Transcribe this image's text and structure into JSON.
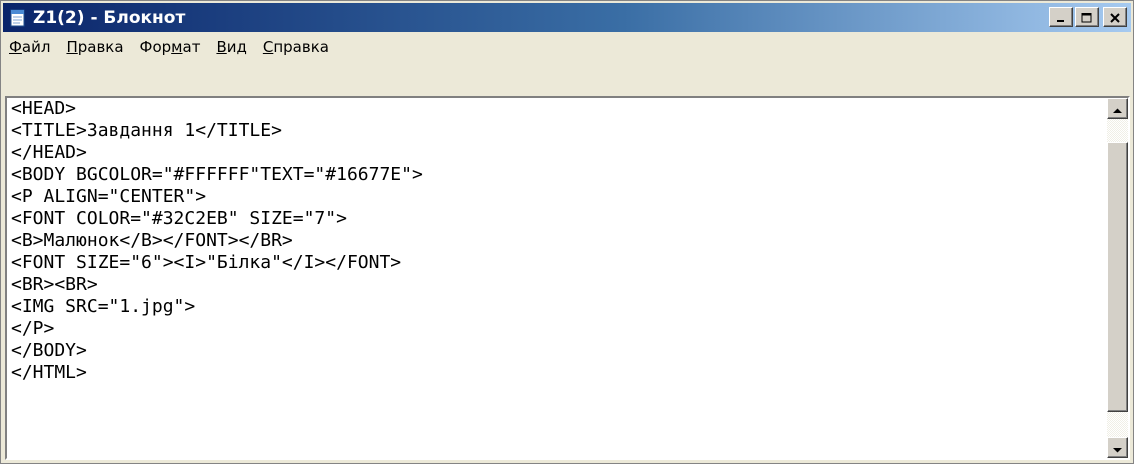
{
  "window": {
    "title": "Z1(2) - Блокнот",
    "icon": "notepad-icon",
    "controls": [
      "minimize-icon",
      "maximize-icon",
      "close-icon"
    ]
  },
  "menubar": {
    "items": [
      {
        "label": "Файл",
        "underline_index": 0
      },
      {
        "label": "Правка",
        "underline_index": 0
      },
      {
        "label": "Формат",
        "underline_index": 3
      },
      {
        "label": "Вид",
        "underline_index": 0
      },
      {
        "label": "Справка",
        "underline_index": 0
      }
    ]
  },
  "editor": {
    "lines": [
      "<HEAD>",
      "<TITLE>Завдання 1</TITLE>",
      "</HEAD>",
      "<BODY BGCOLOR=\"#FFFFFF\"TEXT=\"#16677E\">",
      "<P ALIGN=\"CENTER\">",
      "<FONT COLOR=\"#32C2EB\" SIZE=\"7\">",
      "<B>Малюнок</B></FONT></BR>",
      "<FONT SIZE=\"6\"><I>\"Білка\"</I></FONT>",
      "<BR><BR>",
      "<IMG SRC=\"1.jpg\">",
      "</P>",
      "</BODY>",
      "</HTML>"
    ]
  },
  "colors": {
    "titlebar_start": "#0a246a",
    "titlebar_end": "#a6caf0",
    "window_face": "#ece9d8"
  }
}
